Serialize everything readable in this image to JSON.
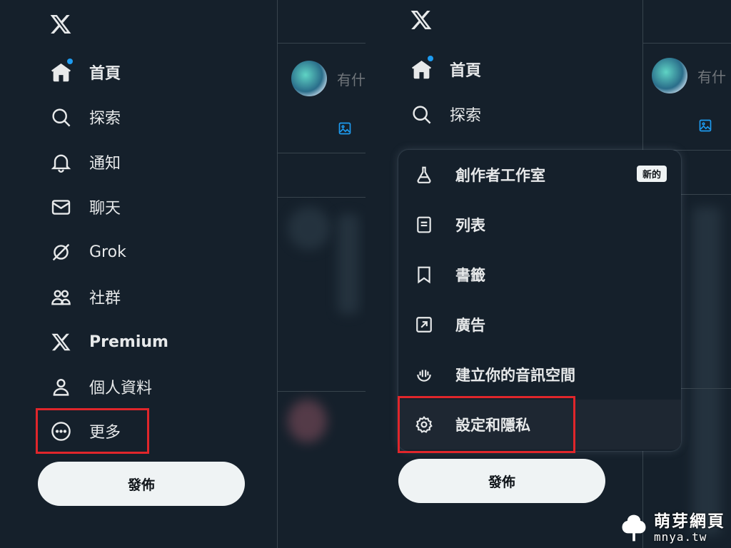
{
  "left_nav": [
    {
      "label": "首頁",
      "icon": "home-icon",
      "active": true
    },
    {
      "label": "探索",
      "icon": "search-icon"
    },
    {
      "label": "通知",
      "icon": "bell-icon"
    },
    {
      "label": "聊天",
      "icon": "envelope-icon"
    },
    {
      "label": "Grok",
      "icon": "grok-icon"
    },
    {
      "label": "社群",
      "icon": "communities-icon"
    },
    {
      "label": "Premium",
      "icon": "x-logo-icon"
    },
    {
      "label": "個人資料",
      "icon": "profile-icon"
    },
    {
      "label": "更多",
      "icon": "more-circle-icon"
    }
  ],
  "right_nav": [
    {
      "label": "首頁",
      "icon": "home-icon",
      "active": true
    },
    {
      "label": "探索",
      "icon": "search-icon"
    }
  ],
  "post_button": "發佈",
  "composer_placeholder": "有什",
  "more_menu": {
    "items": [
      {
        "label": "創作者工作室",
        "icon": "flask-icon",
        "badge": "新的"
      },
      {
        "label": "列表",
        "icon": "list-icon"
      },
      {
        "label": "書籤",
        "icon": "bookmark-icon"
      },
      {
        "label": "廣告",
        "icon": "ads-arrow-icon"
      },
      {
        "label": "建立你的音訊空間",
        "icon": "spaces-mic-icon"
      },
      {
        "label": "設定和隱私",
        "icon": "settings-gear-icon",
        "highlighted": true
      }
    ]
  },
  "watermark": {
    "cn": "萌芽網頁",
    "en": "mnya.tw"
  },
  "colors": {
    "background": "#15202b",
    "accent": "#1d9bf0",
    "highlight": "#e0262b",
    "text": "#e7e9ea"
  }
}
